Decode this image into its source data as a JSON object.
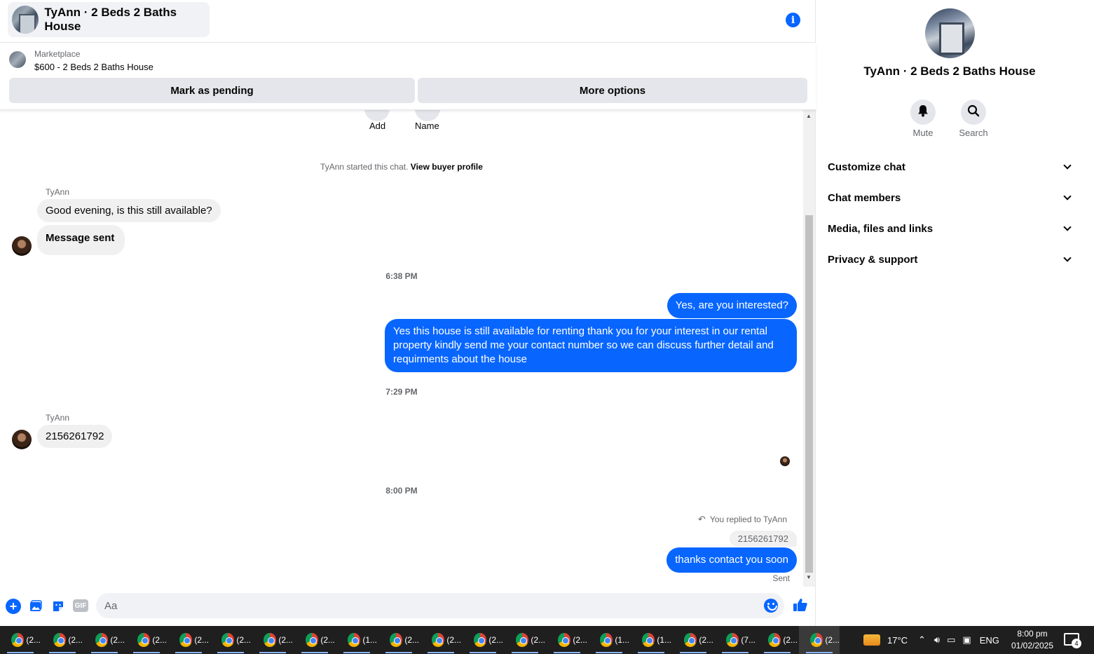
{
  "header": {
    "title": "TyAnn · 2 Beds 2 Baths House",
    "info_icon": "info-icon"
  },
  "marketplace": {
    "label": "Marketplace",
    "listing": "$600 - 2 Beds 2 Baths House",
    "mark_pending": "Mark as pending",
    "more_options": "More options"
  },
  "top_actions": {
    "add": "Add",
    "name": "Name"
  },
  "started": {
    "text": "TyAnn started this chat.",
    "link": "View buyer profile"
  },
  "messages": {
    "sender1": "TyAnn",
    "in1": "Good evening, is this still available?",
    "in2": "Message sent",
    "time1": "6:38 PM",
    "out1": "Yes, are you interested?",
    "out2": "Yes this house is still available for renting thank you for your interest in our rental property kindly send me your contact number so we can discuss further detail and requirments about the house",
    "time2": "7:29 PM",
    "sender2": "TyAnn",
    "in3": "2156261792",
    "time3": "8:00 PM",
    "replied": "You replied to TyAnn",
    "quoted": "2156261792",
    "out3": "thanks contact you soon",
    "status": "Sent"
  },
  "composer": {
    "placeholder": "Aa",
    "gif": "GIF"
  },
  "panel": {
    "name": "TyAnn · 2 Beds 2 Baths House",
    "mute": "Mute",
    "search": "Search",
    "sections": [
      "Customize chat",
      "Chat members",
      "Media, files and links",
      "Privacy & support"
    ]
  },
  "taskbar": {
    "tabs": [
      "(2...",
      "(2...",
      "(2...",
      "(2...",
      "(2...",
      "(2...",
      "(2...",
      "(2...",
      "(1...",
      "(2...",
      "(2...",
      "(2...",
      "(2...",
      "(2...",
      "(1...",
      "(1...",
      "(2...",
      "(7...",
      "(2...",
      "(2..."
    ],
    "temperature": "17°C",
    "language": "ENG",
    "time": "8:00 pm",
    "date": "01/02/2025",
    "notifications": "4"
  },
  "colors": {
    "accent": "#0866ff",
    "bubble_in": "#f0f0f0",
    "taskbar": "#1f1f1f"
  }
}
